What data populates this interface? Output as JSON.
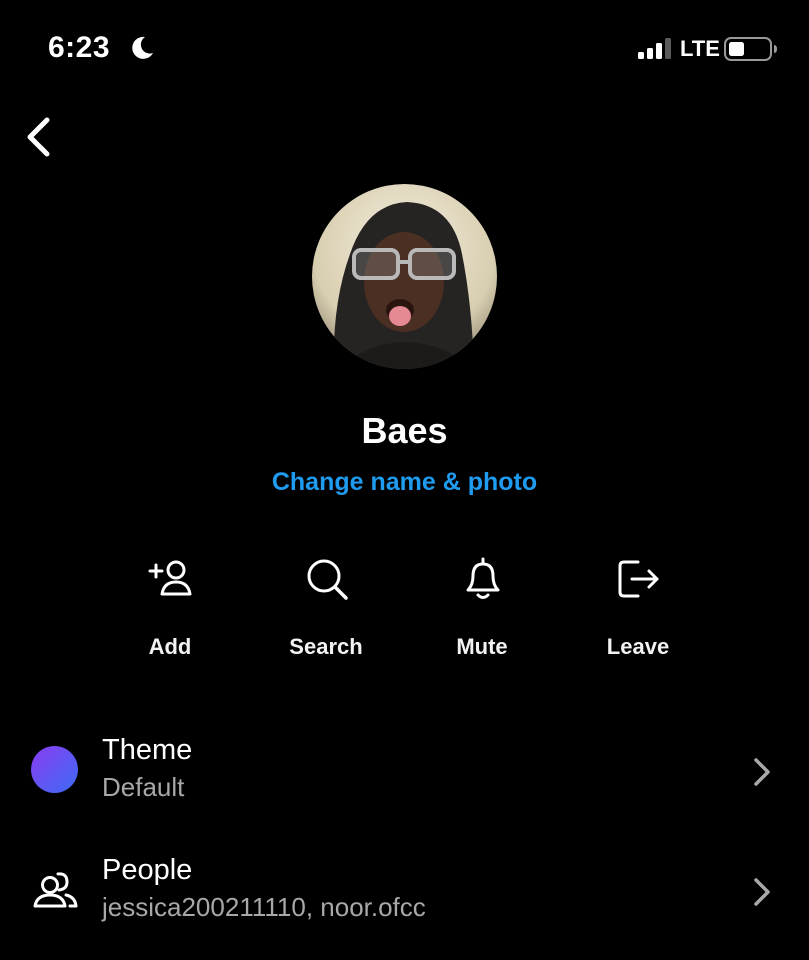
{
  "status_bar": {
    "time": "6:23",
    "carrier": "LTE",
    "icons": [
      "moon-icon",
      "signal-icon",
      "battery-icon"
    ]
  },
  "nav": {
    "back_icon": "chevron-left-icon"
  },
  "group": {
    "name": "Baes",
    "change_link": "Change name & photo",
    "link_color": "#1f9bf0"
  },
  "actions": [
    {
      "label": "Add",
      "icon": "add-person-icon"
    },
    {
      "label": "Search",
      "icon": "search-icon"
    },
    {
      "label": "Mute",
      "icon": "bell-icon"
    },
    {
      "label": "Leave",
      "icon": "leave-icon"
    }
  ],
  "settings": {
    "theme": {
      "title": "Theme",
      "value": "Default",
      "colors": [
        "#8a3cf2",
        "#3d6cf5"
      ]
    },
    "people": {
      "title": "People",
      "value": "jessica200211110, noor.ofcc"
    }
  }
}
